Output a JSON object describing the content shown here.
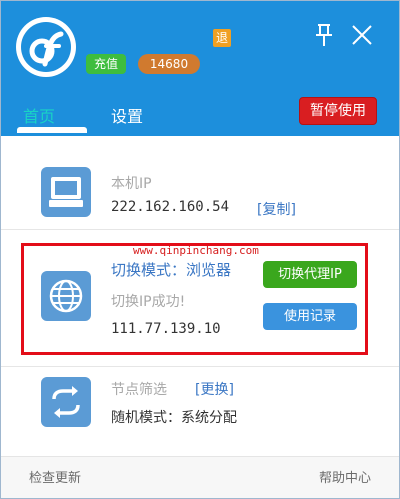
{
  "header": {
    "logo_icon": "app-logo-icon",
    "back_badge": "退",
    "recharge_label": "充值",
    "score_value": "14680",
    "pin_icon": "pin-icon",
    "close_icon": "close-icon"
  },
  "tabs": [
    {
      "label": "首页",
      "active": true
    },
    {
      "label": "设置",
      "active": false
    }
  ],
  "pause_button": "暂停使用",
  "local_ip": {
    "label": "本机IP",
    "value": "222.162.160.54",
    "copy_link": "[复制]",
    "icon": "monitor-icon"
  },
  "switch_panel": {
    "mode_text": "切换模式：浏览器",
    "status_text": "切换IP成功!",
    "ip_value": "111.77.139.10",
    "switch_button": "切换代理IP",
    "history_button": "使用记录",
    "icon": "globe-icon",
    "watermark": "www.qinpinchang.com"
  },
  "node_filter": {
    "label": "节点筛选",
    "change_link": "[更换]",
    "mode_text": "随机模式：系统分配",
    "icon": "refresh-icon"
  },
  "footer": {
    "check_update": "检查更新",
    "help_center": "帮助中心"
  },
  "colors": {
    "header_bg": "#1d8fdc",
    "active_tab": "#19d3c6",
    "pause_red": "#d91e21",
    "highlight_red": "#e30d18",
    "switch_green": "#3aa71d",
    "history_blue": "#3a93de"
  }
}
